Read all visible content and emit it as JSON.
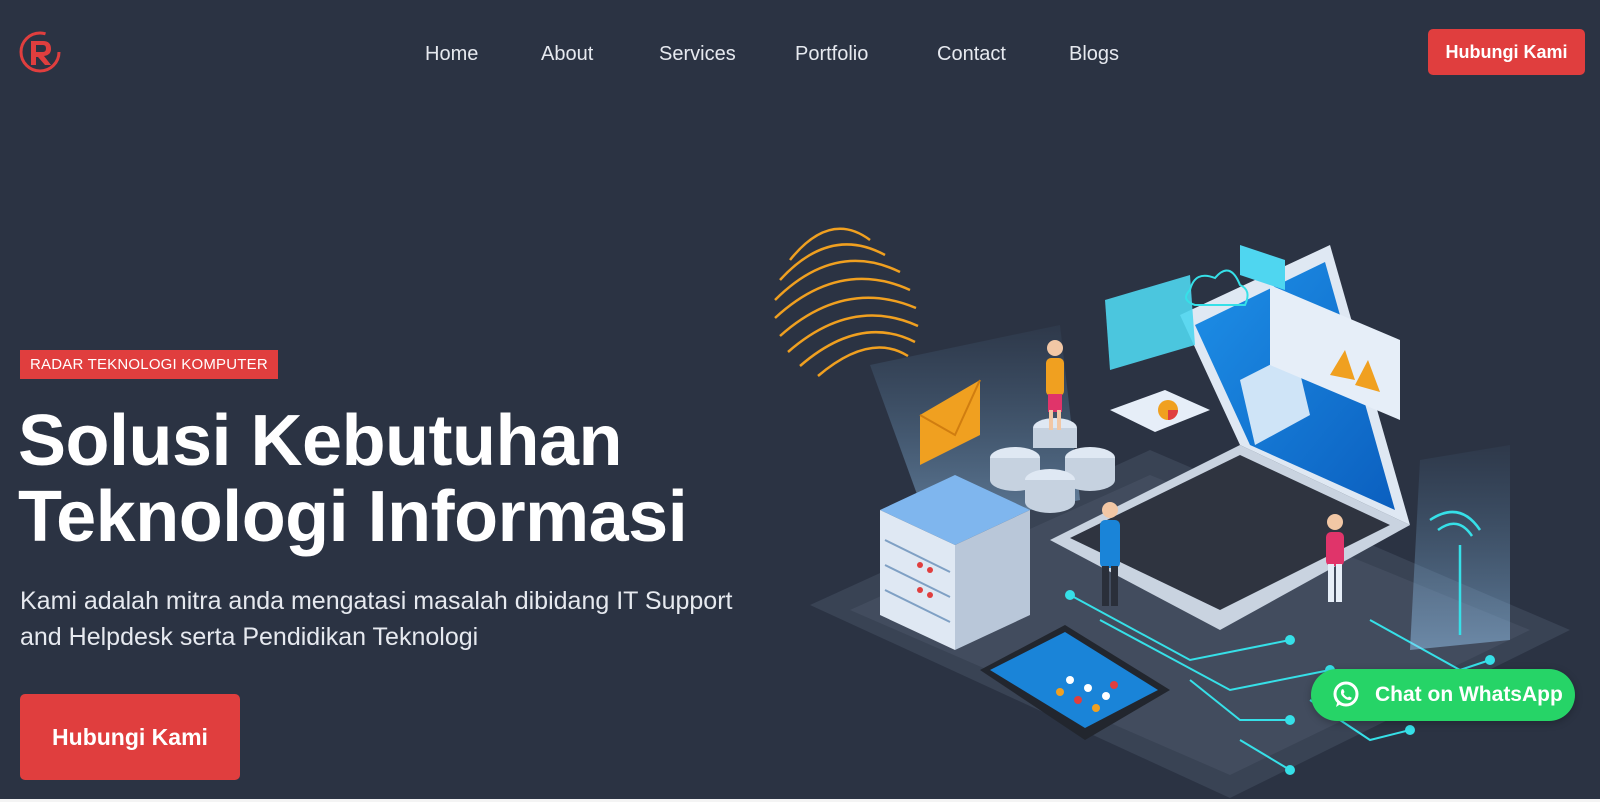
{
  "brand": {
    "logo_icon": "radar-r-logo",
    "accent_color": "#e03e3e",
    "background_color": "#2b3343"
  },
  "nav": {
    "items": [
      "Home",
      "About",
      "Services",
      "Portfolio",
      "Contact",
      "Blogs"
    ],
    "cta_label": "Hubungi Kami"
  },
  "hero": {
    "tag": "RADAR TEKNOLOGI KOMPUTER",
    "title_line1": "Solusi Kebutuhan",
    "title_line2": "Teknologi Informasi",
    "subtitle_line1": "Kami adalah mitra anda mengatasi masalah dibidang IT Support",
    "subtitle_line2": "and Helpdesk serta Pendidikan Teknologi",
    "cta_label": "Hubungi Kami",
    "illustration_icon": "isometric-it-network-illustration"
  },
  "whatsapp": {
    "label": "Chat on WhatsApp",
    "icon": "whatsapp-icon",
    "color": "#26d467"
  }
}
